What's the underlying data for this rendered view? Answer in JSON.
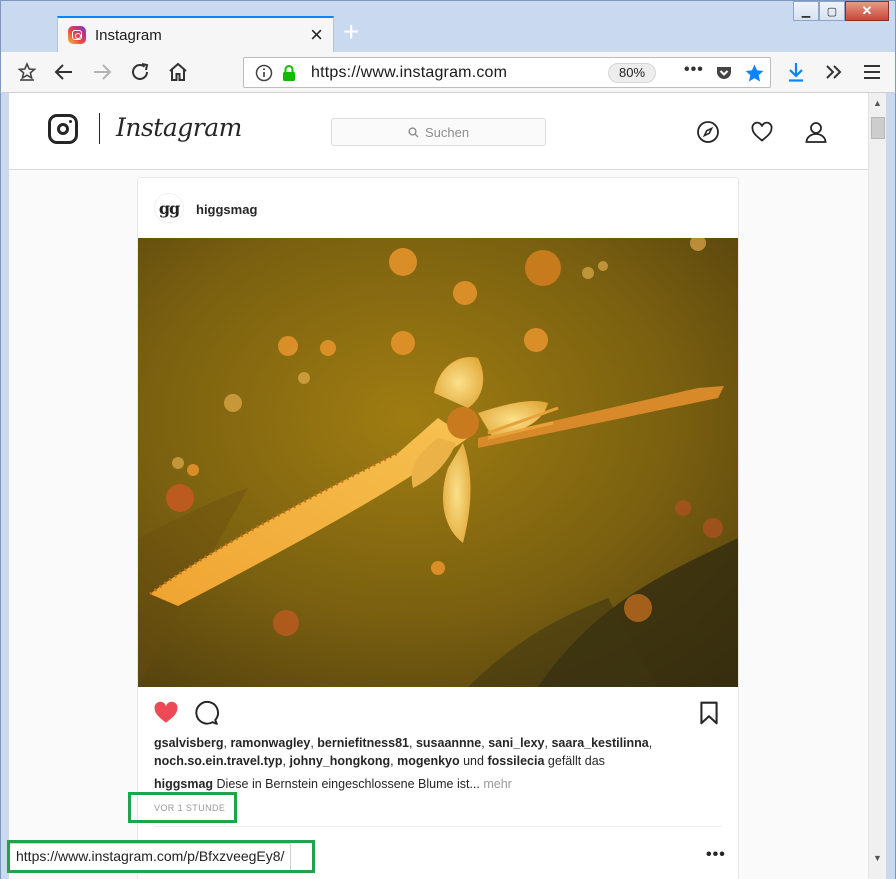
{
  "browser": {
    "tab_title": "Instagram",
    "url": "https://www.instagram.com",
    "zoom": "80%",
    "status_url": "https://www.instagram.com/p/BfxzveegEy8/",
    "accent_color": "#0a84ff"
  },
  "instagram": {
    "wordmark": "Instagram",
    "search_placeholder": "Suchen",
    "post": {
      "username": "higgsmag",
      "avatar_text": "gg",
      "liked_by": [
        "gsalvisberg",
        "ramonwagley",
        "berniefitness81",
        "susaannne",
        "sani_lexy",
        "saara_kestilinna",
        "noch.so.ein.travel.typ",
        "johny_hongkong",
        "mogenkyo",
        "fossilecia"
      ],
      "likes_sep": ", ",
      "likes_and": "und",
      "likes_suffix": "gefällt das",
      "caption_user": "higgsmag",
      "caption_text": "Diese in Bernstein eingeschlossene Blume ist...",
      "caption_more": "mehr",
      "time_ago": "VOR 1 STUNDE",
      "liked": true,
      "image_subject": "flower-in-amber"
    }
  }
}
